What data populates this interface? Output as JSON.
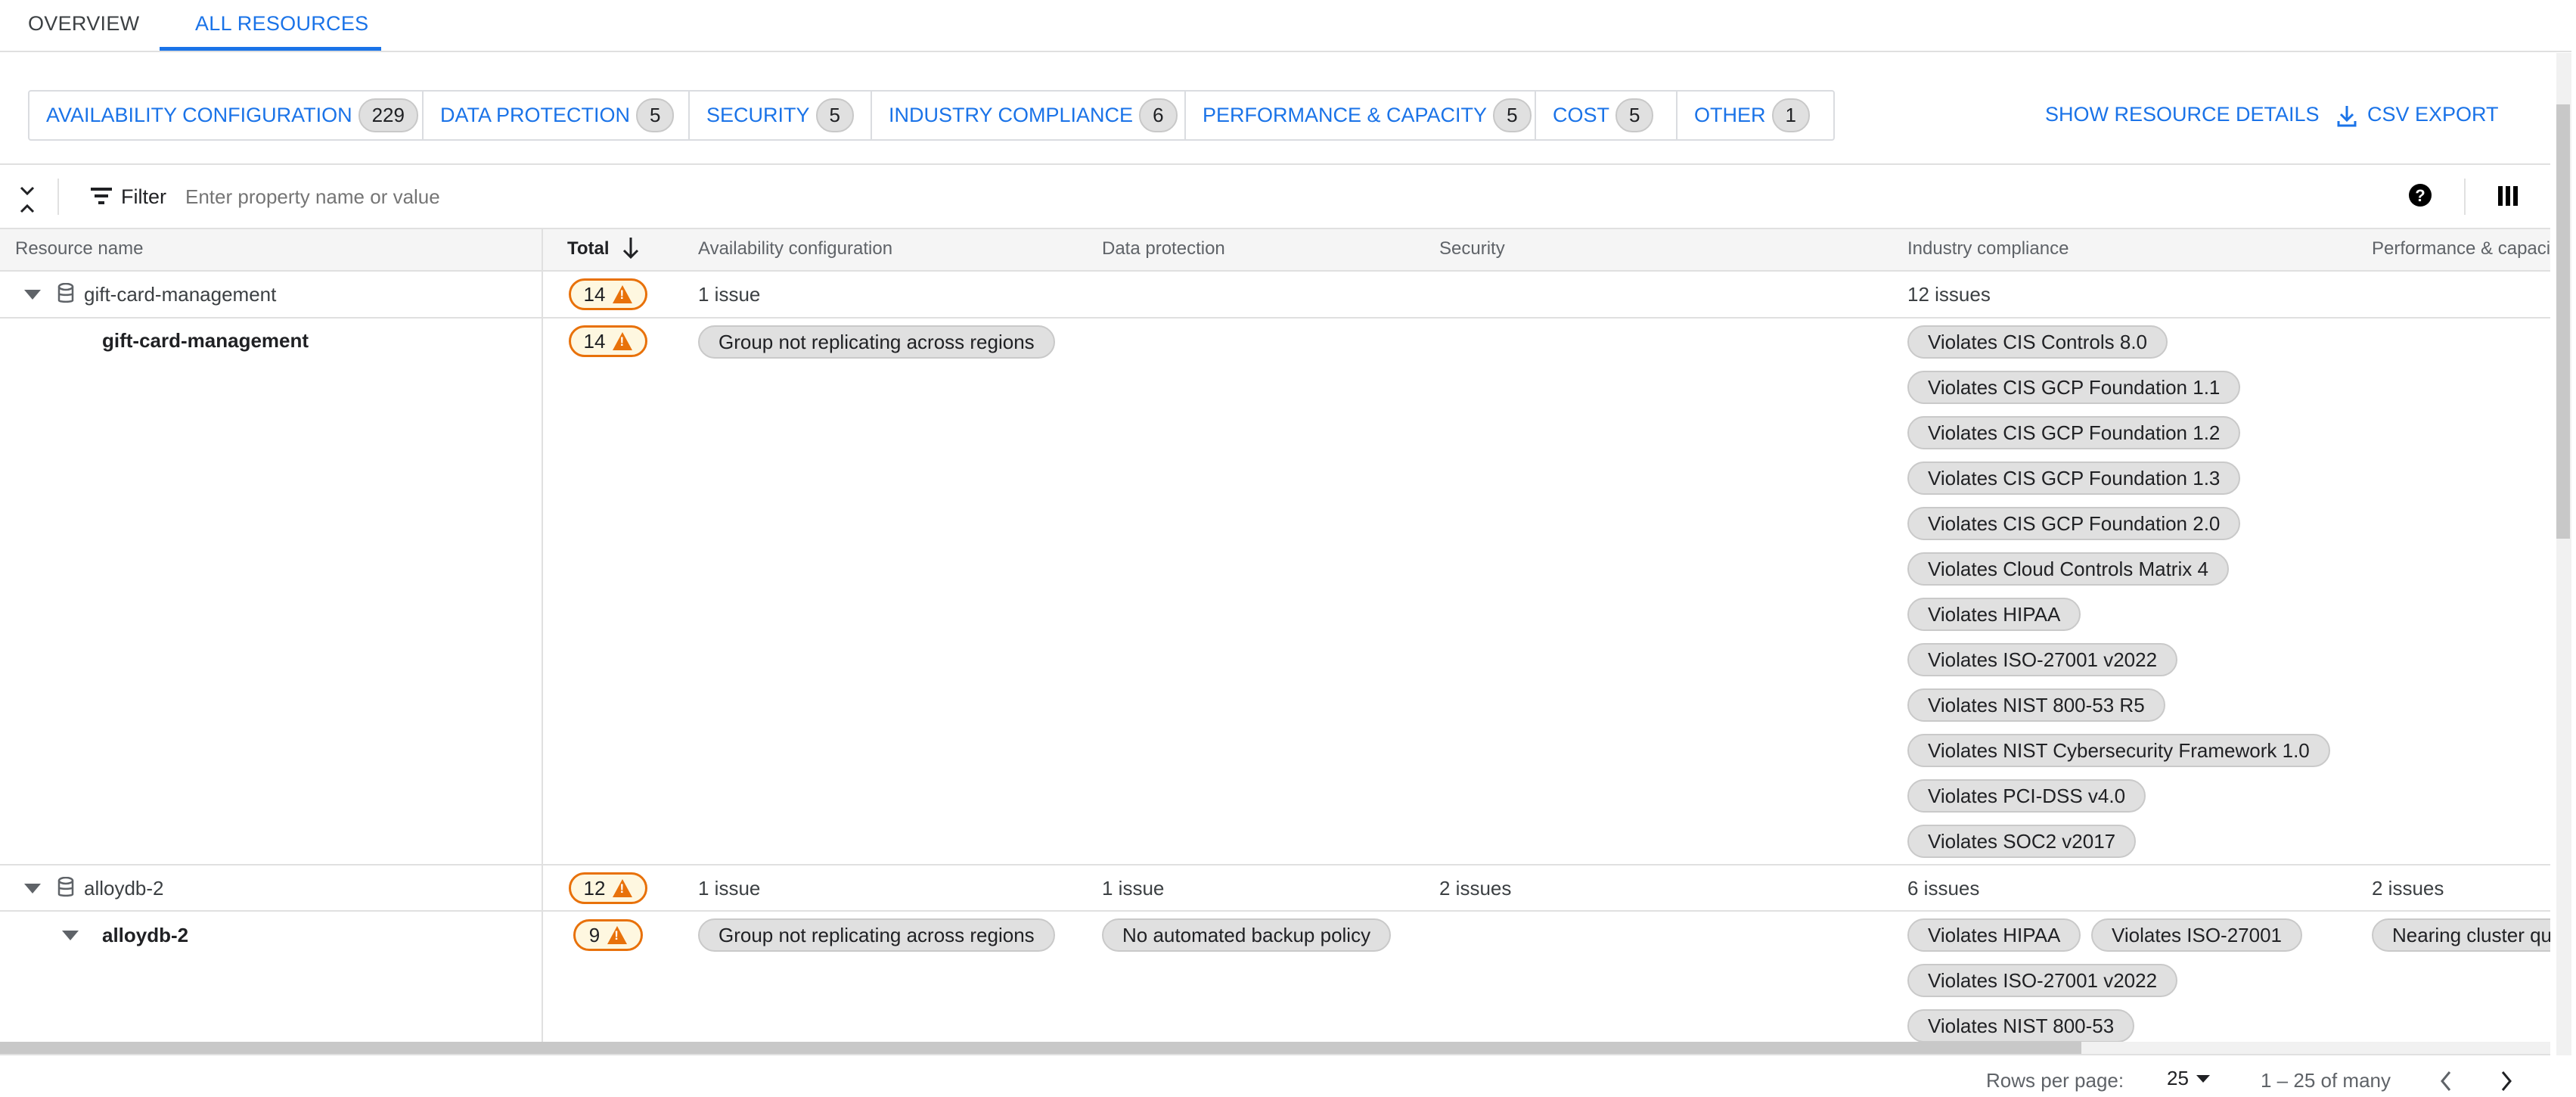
{
  "tabs": [
    {
      "label": "OVERVIEW",
      "active": false
    },
    {
      "label": "ALL RESOURCES",
      "active": true
    }
  ],
  "categories": [
    {
      "label": "AVAILABILITY CONFIGURATION",
      "count": "229"
    },
    {
      "label": "DATA PROTECTION",
      "count": "5"
    },
    {
      "label": "SECURITY",
      "count": "5"
    },
    {
      "label": "INDUSTRY COMPLIANCE",
      "count": "6"
    },
    {
      "label": "PERFORMANCE & CAPACITY",
      "count": "5"
    },
    {
      "label": "COST",
      "count": "5"
    },
    {
      "label": "OTHER",
      "count": "1"
    }
  ],
  "actions": {
    "show_details": "SHOW RESOURCE DETAILS",
    "csv_export": "CSV EXPORT"
  },
  "toolbar": {
    "filter_label": "Filter",
    "filter_placeholder": "Enter property name or value"
  },
  "columns": [
    "Resource name",
    "Total",
    "Availability configuration",
    "Data protection",
    "Security",
    "Industry compliance",
    "Performance & capacity"
  ],
  "accent": "#1a73e8",
  "warning_color": "#e8710a",
  "rows": [
    {
      "group": "gift-card-management",
      "total": "14",
      "avail": "1 issue",
      "industry": "12 issues",
      "child": {
        "name": "gift-card-management",
        "total": "14",
        "avail_chips": [
          "Group not replicating across regions"
        ],
        "industry_chips": [
          "Violates CIS Controls 8.0",
          "Violates CIS GCP Foundation 1.1",
          "Violates CIS GCP Foundation 1.2",
          "Violates CIS GCP Foundation 1.3",
          "Violates CIS GCP Foundation 2.0",
          "Violates Cloud Controls Matrix 4",
          "Violates HIPAA",
          "Violates ISO-27001 v2022",
          "Violates NIST 800-53 R5",
          "Violates NIST Cybersecurity Framework 1.0",
          "Violates PCI-DSS v4.0",
          "Violates SOC2 v2017"
        ]
      }
    },
    {
      "group": "alloydb-2",
      "total": "12",
      "avail": "1 issue",
      "data": "1 issue",
      "security": "2 issues",
      "industry": "6 issues",
      "perf": "2 issues",
      "child": {
        "name": "alloydb-2",
        "total": "9",
        "avail_chips": [
          "Group not replicating across regions"
        ],
        "data_chips": [
          "No automated backup policy"
        ],
        "industry_chips": [
          "Violates HIPAA",
          "Violates ISO-27001",
          "Violates ISO-27001 v2022",
          "Violates NIST 800-53"
        ],
        "perf_chips": [
          "Nearing cluster quota"
        ]
      }
    }
  ],
  "footer": {
    "rows_per_page_label": "Rows per page:",
    "rows_per_page": "25",
    "range": "1 – 25 of many"
  }
}
